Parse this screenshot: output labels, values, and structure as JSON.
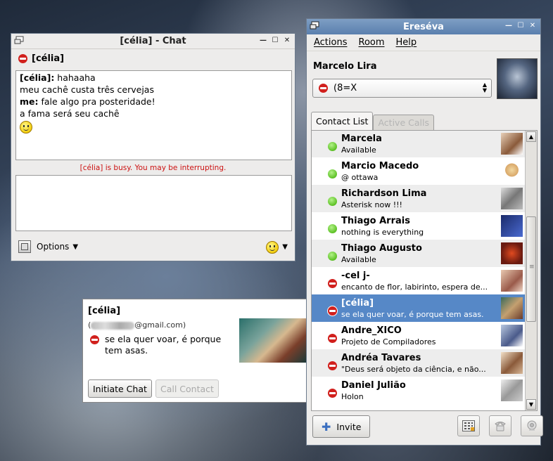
{
  "chat_window": {
    "title": "[célia] - Chat",
    "contact": "[célia]",
    "messages": [
      {
        "sender": "[célia]:",
        "text": " hahaaha"
      },
      {
        "sender": "",
        "text": "meu cachê custa três cervejas"
      },
      {
        "sender": "me:",
        "text": " fale algo pra posteridade!"
      },
      {
        "sender": "",
        "text": "a fama será seu cachê"
      }
    ],
    "busy_notice": "[célia] is busy. You may be interrupting.",
    "options_label": "Options"
  },
  "popup": {
    "name": "[célia]",
    "email_open": "(",
    "email_domain": "@gmail.com)",
    "status": "se ela quer voar, é porque tem asas.",
    "initiate_chat": "Initiate Chat",
    "call_contact": "Call Contact"
  },
  "roster": {
    "title": "Ereséva",
    "menu": [
      "Actions",
      "Room",
      "Help"
    ],
    "account_name": "Marcelo Lira",
    "status_text": "(8=X",
    "tabs": [
      "Contact List",
      "Active Calls"
    ],
    "contacts": [
      {
        "name": "Marcela",
        "status": "Available",
        "presence": "available"
      },
      {
        "name": "Marcio Macedo",
        "status": "@ ottawa",
        "presence": "available"
      },
      {
        "name": "Richardson Lima",
        "status": "Asterisk now !!!",
        "presence": "available"
      },
      {
        "name": "Thiago Arrais",
        "status": "nothing is everything",
        "presence": "available"
      },
      {
        "name": "Thiago Augusto",
        "status": "Available",
        "presence": "available"
      },
      {
        "name": "-cel j-",
        "status": "encanto de flor, labirinto, espera de...",
        "presence": "busy"
      },
      {
        "name": "[célia]",
        "status": "se ela quer voar, é porque tem asas.",
        "presence": "busy"
      },
      {
        "name": "Andre_XICO",
        "status": "Projeto de Compiladores",
        "presence": "busy"
      },
      {
        "name": "Andréa Tavares",
        "status": "\"Deus será objeto da ciência, e não...",
        "presence": "busy"
      },
      {
        "name": "Daniel Julião",
        "status": "Holon",
        "presence": "busy"
      }
    ],
    "invite_label": "Invite"
  },
  "colors": {
    "selection": "#5688c7",
    "available": "#5cc124",
    "busy": "#d1201d",
    "titlebar_active": "#6a8cb9"
  }
}
